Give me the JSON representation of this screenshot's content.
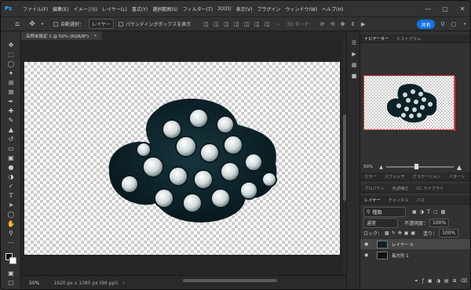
{
  "app": {
    "logo": "Ps"
  },
  "menubar": {
    "items": [
      "ファイル(F)",
      "編集(E)",
      "イメージ(I)",
      "レイヤー(L)",
      "書式(Y)",
      "選択範囲(S)",
      "フィルター(T)",
      "3D(D)",
      "表示(V)",
      "プラグイン",
      "ウィンドウ(W)",
      "ヘルプ(H)"
    ]
  },
  "options_bar": {
    "auto_select_label": "自動選択：",
    "auto_select_target": "レイヤー",
    "bounding_box_label": "バウンディングボックスを表示",
    "mode_3d_label": "3D モード：",
    "share_label": "共有"
  },
  "document": {
    "tab_title": "名称未設定 1 @ 50% (RGB/8*)",
    "zoom": "50%",
    "size_info": "1920 px x 1080 px (96 ppi)"
  },
  "panels": {
    "navigator_tabs": [
      "ナビゲーター",
      "ヒストグラム"
    ],
    "navigator_zoom": "50%",
    "color_tabs": [
      "カラー",
      "スウォッチ",
      "グラデーション",
      "パターン"
    ],
    "property_tabs": [
      "プロパティ",
      "色調補正",
      "CC ライブラリ"
    ],
    "layer_tabs": [
      "レイヤー",
      "チャンネル",
      "パス"
    ],
    "filter_kind": "種類",
    "blend_mode": "通常",
    "opacity_label": "不透明度：",
    "opacity_value": "100%",
    "lock_label": "ロック：",
    "fill_label": "塗り：",
    "fill_value": "100%",
    "layers": [
      {
        "name": "レイヤー 0"
      },
      {
        "name": "長方形 1"
      }
    ]
  },
  "colors": {
    "accent": "#1473e6",
    "navigator_frame": "#e23b3b",
    "canvas_bg": "#262626"
  }
}
